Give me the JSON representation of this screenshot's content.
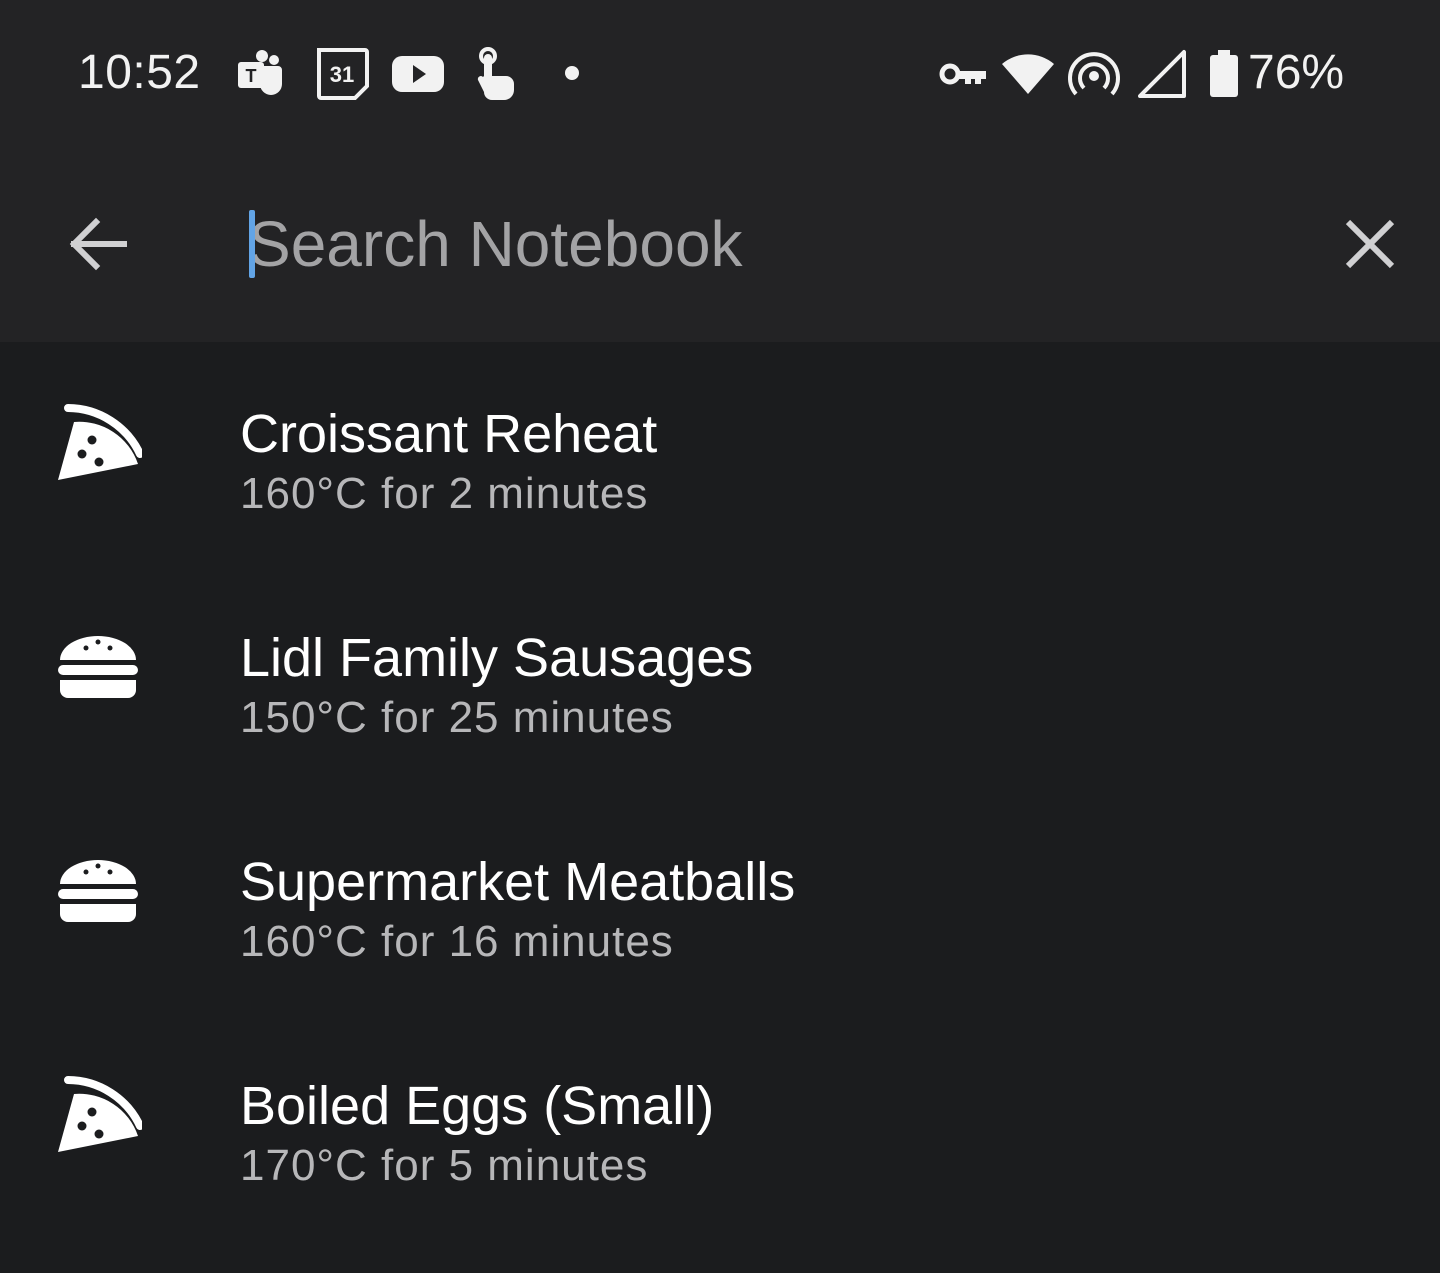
{
  "status_bar": {
    "time": "10:52",
    "notification_icons": [
      "teams-icon",
      "calendar-icon",
      "youtube-icon",
      "touch-icon",
      "dot-icon"
    ],
    "calendar_date": "31",
    "system_icons": [
      "vpn-key-icon",
      "wifi-icon",
      "hotspot-icon",
      "signal-icon",
      "battery-icon"
    ],
    "battery": "76%"
  },
  "search": {
    "value": "",
    "placeholder": "Search Notebook"
  },
  "colors": {
    "background": "#1b1c1e",
    "bar": "#232325",
    "primary_text": "#ffffff",
    "secondary_text": "#b7b7b9",
    "cursor": "#62a4e6"
  },
  "items": [
    {
      "icon": "pizza-icon",
      "title": "Croissant Reheat",
      "subtitle": "160°C for 2 minutes"
    },
    {
      "icon": "burger-icon",
      "title": "Lidl Family Sausages",
      "subtitle": "150°C for 25 minutes"
    },
    {
      "icon": "burger-icon",
      "title": "Supermarket Meatballs",
      "subtitle": "160°C for 16 minutes"
    },
    {
      "icon": "pizza-icon",
      "title": "Boiled Eggs (Small)",
      "subtitle": "170°C for 5 minutes"
    }
  ]
}
